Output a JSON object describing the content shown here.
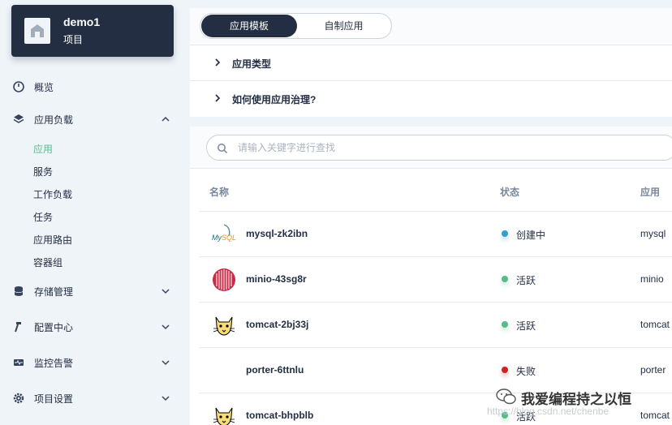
{
  "project": {
    "name": "demo1",
    "subtitle": "项目"
  },
  "sidebar": {
    "items": [
      {
        "label": "概览",
        "icon": "dashboard-icon"
      },
      {
        "label": "应用负载",
        "icon": "layers-icon",
        "expanded": true
      },
      {
        "label": "存储管理",
        "icon": "database-icon"
      },
      {
        "label": "配置中心",
        "icon": "hammer-icon"
      },
      {
        "label": "监控告警",
        "icon": "monitor-icon"
      },
      {
        "label": "项目设置",
        "icon": "gear-icon"
      }
    ],
    "sub_items": [
      "应用",
      "服务",
      "工作负载",
      "任务",
      "应用路由",
      "容器组"
    ],
    "active_sub": "应用"
  },
  "tabs": {
    "active": "应用模板",
    "other": "自制应用"
  },
  "collapse": {
    "app_types": "应用类型",
    "how_to": "如何使用应用治理?"
  },
  "search": {
    "placeholder": "请输入关键字进行查找"
  },
  "table": {
    "headers": {
      "name": "名称",
      "status": "状态",
      "app": "应用"
    },
    "rows": [
      {
        "name": "mysql-zk2ibn",
        "status": "创建中",
        "status_color": "#329dce",
        "app": "mysql",
        "logo": "mysql-logo-icon"
      },
      {
        "name": "minio-43sg8r",
        "status": "活跃",
        "status_color": "#55bc8a",
        "app": "minio",
        "logo": "minio-logo-icon"
      },
      {
        "name": "tomcat-2bj33j",
        "status": "活跃",
        "status_color": "#55bc8a",
        "app": "tomcat",
        "logo": "tomcat-logo-icon"
      },
      {
        "name": "porter-6ttnlu",
        "status": "失败",
        "status_color": "#ca2621",
        "app": "porter",
        "logo": ""
      },
      {
        "name": "tomcat-bhpblb",
        "status": "活跃",
        "status_color": "#55bc8a",
        "app": "tomcat",
        "logo": "tomcat-logo-icon"
      }
    ]
  },
  "watermark": {
    "text": "我爱编程持之以恒",
    "url": "https://blog.csdn.net/chenbe"
  }
}
